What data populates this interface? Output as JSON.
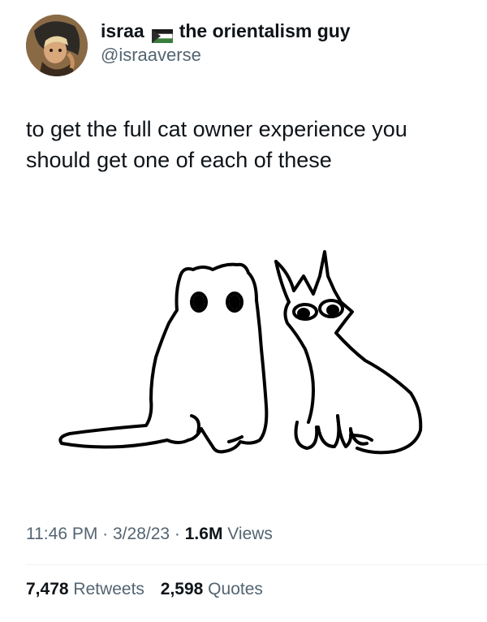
{
  "user": {
    "display_name": "israa",
    "display_name_suffix": "the orientalism guy",
    "handle": "@israaverse",
    "flag_icon": "palestine-flag-icon"
  },
  "tweet": {
    "text": "to get the full cat owner experience you should get one of each of these",
    "image_description_icon": "cat-drawing"
  },
  "meta": {
    "time": "11:46 PM",
    "separator1": " · ",
    "date": "3/28/23",
    "separator2": " · ",
    "views_count": "1.6M",
    "views_label": " Views"
  },
  "stats": {
    "retweets_count": "7,478",
    "retweets_label": " Retweets",
    "quotes_count": "2,598",
    "quotes_label": " Quotes"
  }
}
